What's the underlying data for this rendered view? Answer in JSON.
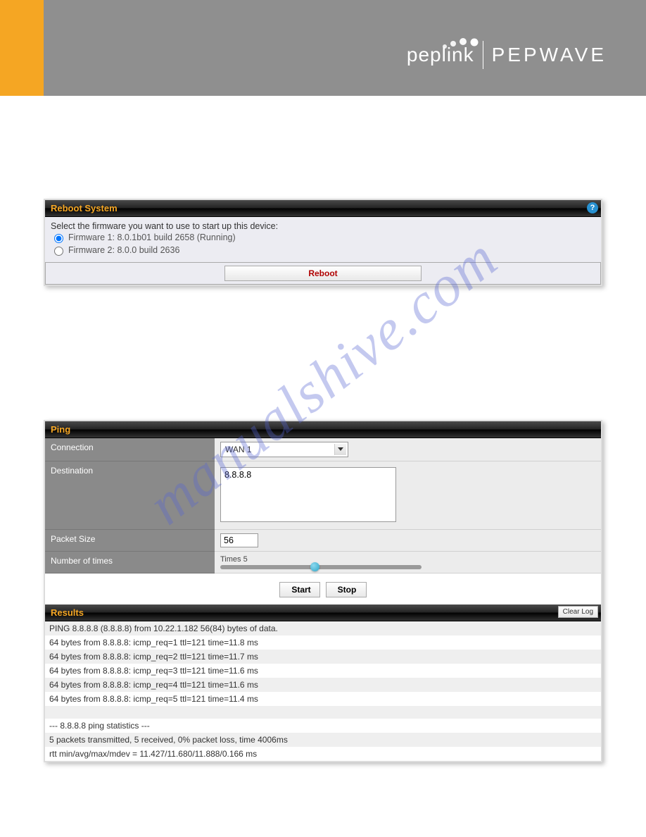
{
  "brand": {
    "peplink": "peplink",
    "pepwave": "PEPWAVE"
  },
  "watermark": "manualshive.com",
  "reboot": {
    "header": "Reboot System",
    "intro": "Select the firmware you want to use to start up this device:",
    "fw1": "Firmware 1: 8.0.1b01 build 2658 (Running)",
    "fw2": "Firmware 2: 8.0.0 build 2636",
    "button": "Reboot"
  },
  "ping": {
    "header": "Ping",
    "labels": {
      "connection": "Connection",
      "destination": "Destination",
      "packet": "Packet Size",
      "times": "Number of times"
    },
    "connection_value": "WAN 1",
    "destination_value": "8.8.8.8",
    "packet_value": "56",
    "times_label": "Times 5",
    "buttons": {
      "start": "Start",
      "stop": "Stop"
    }
  },
  "results": {
    "header": "Results",
    "clear": "Clear Log",
    "rows": [
      "PING 8.8.8.8 (8.8.8.8) from 10.22.1.182 56(84) bytes of data.",
      "64 bytes from 8.8.8.8: icmp_req=1 ttl=121 time=11.8 ms",
      "64 bytes from 8.8.8.8: icmp_req=2 ttl=121 time=11.7 ms",
      "64 bytes from 8.8.8.8: icmp_req=3 ttl=121 time=11.6 ms",
      "64 bytes from 8.8.8.8: icmp_req=4 ttl=121 time=11.6 ms",
      "64 bytes from 8.8.8.8: icmp_req=5 ttl=121 time=11.4 ms",
      "",
      "--- 8.8.8.8 ping statistics ---",
      "5 packets transmitted, 5 received, 0% packet loss, time 4006ms",
      "rtt min/avg/max/mdev = 11.427/11.680/11.888/0.166 ms"
    ]
  },
  "help_glyph": "?"
}
